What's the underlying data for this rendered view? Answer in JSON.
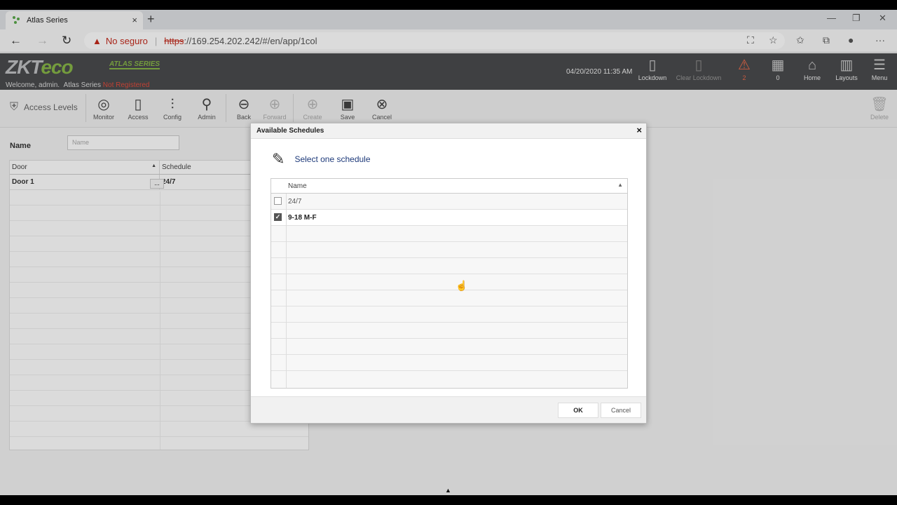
{
  "browser": {
    "tab_title": "Atlas Series",
    "tab_close": "×",
    "new_tab": "+",
    "win_min": "—",
    "win_max": "❐",
    "win_close": "✕",
    "insecure_label": "No seguro",
    "separator": "|",
    "url_protocol": "https",
    "url_rest": "://169.254.202.242/#/en/app/1col"
  },
  "app": {
    "logo_zk": "ZKT",
    "logo_eco": "eco",
    "series": "ATLAS SERIES",
    "welcome": "Welcome, admin.",
    "series_label": "Atlas Series",
    "not_registered": "Not Registered",
    "datetime": "04/20/2020 11:35 AM",
    "header_buttons": [
      {
        "label": "Lockdown",
        "icon": "door-icon"
      },
      {
        "label": "Clear Lockdown",
        "icon": "door-icon"
      },
      {
        "label": "2",
        "icon": "alarm-icon"
      },
      {
        "label": "0",
        "icon": "calendar-icon"
      },
      {
        "label": "Home",
        "icon": "home-icon"
      },
      {
        "label": "Layouts",
        "icon": "layouts-icon"
      },
      {
        "label": "Menu",
        "icon": "menu-icon"
      }
    ]
  },
  "toolbar": {
    "section": "Access Levels",
    "buttons": [
      "Monitor",
      "Access",
      "Config",
      "Admin",
      "Back",
      "Forward",
      "Create",
      "Save",
      "Cancel"
    ],
    "delete": "Delete"
  },
  "main": {
    "name_label": "Name",
    "name_placeholder": "Name",
    "col_door": "Door",
    "col_schedule": "Schedule",
    "row_door": "Door 1",
    "row_dots": "...",
    "row_schedule": "24/7"
  },
  "dialog": {
    "title": "Available Schedules",
    "close": "×",
    "heading": "Select one schedule",
    "col_name": "Name",
    "items": [
      {
        "label": "24/7",
        "checked": false
      },
      {
        "label": "9-18 M-F",
        "checked": true
      }
    ],
    "ok": "OK",
    "cancel": "Cancel"
  }
}
